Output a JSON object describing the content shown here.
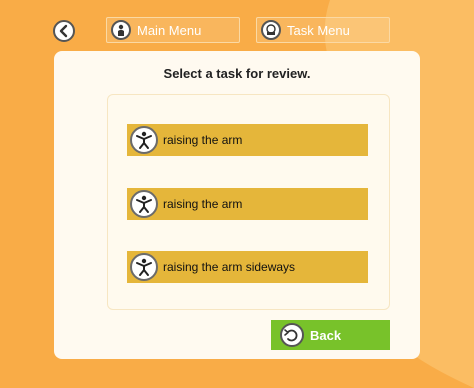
{
  "colors": {
    "background": "#f9ac47",
    "panel": "#fffaf0",
    "task_button": "#e5b63a",
    "back_button": "#78c22a"
  },
  "topbar": {
    "back_icon": "back-arrow-icon",
    "main_menu": {
      "label": "Main Menu",
      "icon": "person-icon"
    },
    "task_menu": {
      "label": "Task Menu",
      "icon": "task-menu-icon"
    }
  },
  "panel": {
    "title": "Select a task for review.",
    "tasks": [
      {
        "label": "raising the arm",
        "icon": "stick-figure-icon"
      },
      {
        "label": "raising the arm",
        "icon": "stick-figure-icon"
      },
      {
        "label": "raising the arm sideways",
        "icon": "stick-figure-icon"
      }
    ],
    "back_button": {
      "label": "Back",
      "icon": "undo-arrow-icon"
    }
  }
}
